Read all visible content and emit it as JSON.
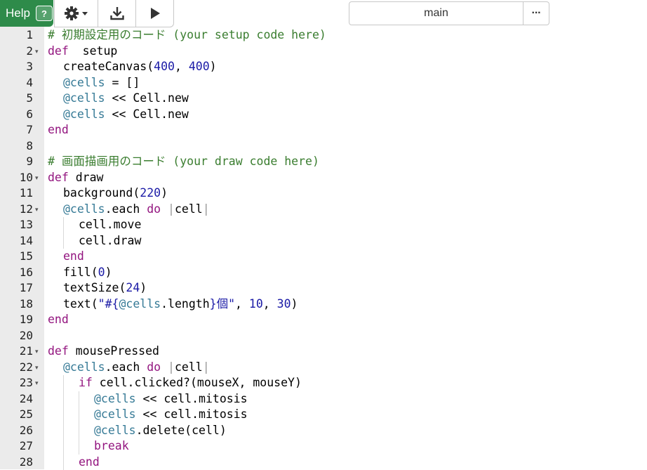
{
  "toolbar": {
    "help_label": "Help",
    "help_badge": "?",
    "branch": "main",
    "more": "···"
  },
  "editor": {
    "lines": [
      {
        "num": "1",
        "indent": 0,
        "fold": false,
        "tokens": [
          [
            "cmt",
            "# 初期設定用のコード (your setup code here)"
          ]
        ]
      },
      {
        "num": "2",
        "indent": 0,
        "fold": true,
        "tokens": [
          [
            "kw",
            "def"
          ],
          [
            "",
            "  setup"
          ]
        ]
      },
      {
        "num": "3",
        "indent": 1,
        "fold": false,
        "tokens": [
          [
            "",
            "createCanvas("
          ],
          [
            "num",
            "400"
          ],
          [
            "",
            ", "
          ],
          [
            "num",
            "400"
          ],
          [
            "",
            ")"
          ]
        ]
      },
      {
        "num": "4",
        "indent": 1,
        "fold": false,
        "tokens": [
          [
            "ivar",
            "@cells"
          ],
          [
            "",
            " = []"
          ]
        ]
      },
      {
        "num": "5",
        "indent": 1,
        "fold": false,
        "tokens": [
          [
            "ivar",
            "@cells"
          ],
          [
            "",
            " << Cell.new"
          ]
        ]
      },
      {
        "num": "6",
        "indent": 1,
        "fold": false,
        "tokens": [
          [
            "ivar",
            "@cells"
          ],
          [
            "",
            " << Cell.new"
          ]
        ]
      },
      {
        "num": "7",
        "indent": 0,
        "fold": false,
        "tokens": [
          [
            "kw",
            "end"
          ]
        ]
      },
      {
        "num": "8",
        "indent": 0,
        "fold": false,
        "tokens": []
      },
      {
        "num": "9",
        "indent": 0,
        "fold": false,
        "tokens": [
          [
            "cmt",
            "# 画面描画用のコード (your draw code here)"
          ]
        ]
      },
      {
        "num": "10",
        "indent": 0,
        "fold": true,
        "tokens": [
          [
            "kw",
            "def"
          ],
          [
            "",
            " draw"
          ]
        ]
      },
      {
        "num": "11",
        "indent": 1,
        "fold": false,
        "tokens": [
          [
            "",
            "background("
          ],
          [
            "num",
            "220"
          ],
          [
            "",
            ")"
          ]
        ]
      },
      {
        "num": "12",
        "indent": 1,
        "fold": true,
        "tokens": [
          [
            "ivar",
            "@cells"
          ],
          [
            "",
            ".each "
          ],
          [
            "kw",
            "do"
          ],
          [
            "",
            " "
          ],
          [
            "bar",
            "|"
          ],
          [
            "",
            "cell"
          ],
          [
            "bar",
            "|"
          ]
        ]
      },
      {
        "num": "13",
        "indent": 2,
        "fold": false,
        "tokens": [
          [
            "",
            "cell.move"
          ]
        ]
      },
      {
        "num": "14",
        "indent": 2,
        "fold": false,
        "tokens": [
          [
            "",
            "cell.draw"
          ]
        ]
      },
      {
        "num": "15",
        "indent": 1,
        "fold": false,
        "tokens": [
          [
            "kw",
            "end"
          ]
        ]
      },
      {
        "num": "16",
        "indent": 1,
        "fold": false,
        "tokens": [
          [
            "",
            "fill("
          ],
          [
            "num",
            "0"
          ],
          [
            "",
            ")"
          ]
        ]
      },
      {
        "num": "17",
        "indent": 1,
        "fold": false,
        "tokens": [
          [
            "",
            "textSize("
          ],
          [
            "num",
            "24"
          ],
          [
            "",
            ")"
          ]
        ]
      },
      {
        "num": "18",
        "indent": 1,
        "fold": false,
        "tokens": [
          [
            "",
            "text("
          ],
          [
            "str",
            "\"#{"
          ],
          [
            "ivar",
            "@cells"
          ],
          [
            "",
            ".length"
          ],
          [
            "str",
            "}個\""
          ],
          [
            "",
            ", "
          ],
          [
            "num",
            "10"
          ],
          [
            "",
            ", "
          ],
          [
            "num",
            "30"
          ],
          [
            "",
            ")"
          ]
        ]
      },
      {
        "num": "19",
        "indent": 0,
        "fold": false,
        "tokens": [
          [
            "kw",
            "end"
          ]
        ]
      },
      {
        "num": "20",
        "indent": 0,
        "fold": false,
        "tokens": []
      },
      {
        "num": "21",
        "indent": 0,
        "fold": true,
        "tokens": [
          [
            "kw",
            "def"
          ],
          [
            "",
            " mousePressed"
          ]
        ]
      },
      {
        "num": "22",
        "indent": 1,
        "fold": true,
        "tokens": [
          [
            "ivar",
            "@cells"
          ],
          [
            "",
            ".each "
          ],
          [
            "kw",
            "do"
          ],
          [
            "",
            " "
          ],
          [
            "bar",
            "|"
          ],
          [
            "",
            "cell"
          ],
          [
            "bar",
            "|"
          ]
        ]
      },
      {
        "num": "23",
        "indent": 2,
        "fold": true,
        "tokens": [
          [
            "kw",
            "if"
          ],
          [
            "",
            " cell.clicked?(mouseX, mouseY)"
          ]
        ]
      },
      {
        "num": "24",
        "indent": 3,
        "fold": false,
        "tokens": [
          [
            "ivar",
            "@cells"
          ],
          [
            "",
            " << cell.mitosis"
          ]
        ]
      },
      {
        "num": "25",
        "indent": 3,
        "fold": false,
        "tokens": [
          [
            "ivar",
            "@cells"
          ],
          [
            "",
            " << cell.mitosis"
          ]
        ]
      },
      {
        "num": "26",
        "indent": 3,
        "fold": false,
        "tokens": [
          [
            "ivar",
            "@cells"
          ],
          [
            "",
            ".delete(cell)"
          ]
        ]
      },
      {
        "num": "27",
        "indent": 3,
        "fold": false,
        "tokens": [
          [
            "kw",
            "break"
          ]
        ]
      },
      {
        "num": "28",
        "indent": 2,
        "fold": false,
        "tokens": [
          [
            "kw",
            "end"
          ]
        ]
      }
    ]
  },
  "colors": {
    "help_bg": "#2e8b4a",
    "gutter_bg": "#ebebeb",
    "keyword": "#93157f",
    "ivar": "#367a96",
    "number": "#1a1aa6",
    "comment": "#3a7d2f"
  }
}
